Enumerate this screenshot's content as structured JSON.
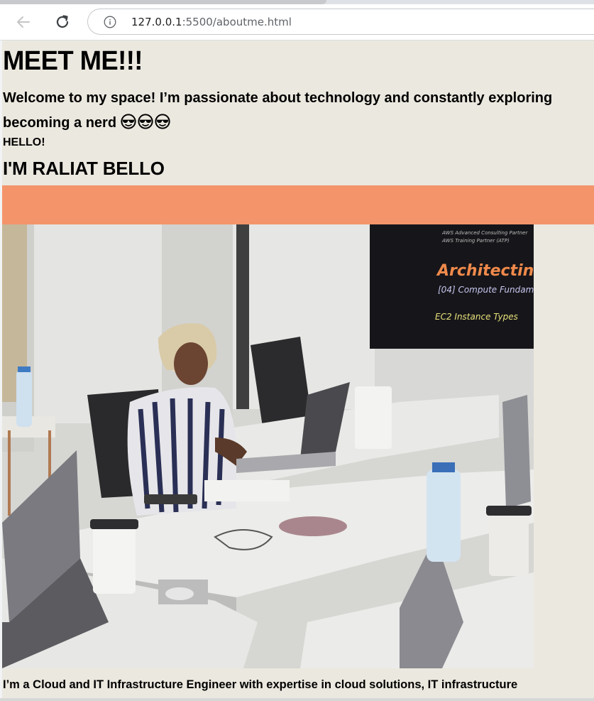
{
  "browser": {
    "url_host": "127.0.0.1",
    "url_rest": ":5500/aboutme.html"
  },
  "page": {
    "heading": "MEET ME!!!",
    "intro_line1": "Welcome to my space! I’m passionate about technology and constantly exploring",
    "intro_line2": "becoming a nerd",
    "intro_emoji": "😎😎😎",
    "hello": "HELLO!",
    "name": "I'M RALIAT BELLO",
    "banner_color": "#f4946b",
    "background_color": "#ebe8df",
    "photo": {
      "screen_lines": [
        "AWS Advanced Consulting Partner",
        "AWS Training Partner (ATP)"
      ],
      "screen_title": "Architecting",
      "screen_subtitle": "[04] Compute Fundam",
      "screen_topic": "EC2 Instance Types"
    },
    "bio": "I’m a Cloud and IT Infrastructure Engineer with expertise in cloud solutions, IT infrastructure"
  }
}
